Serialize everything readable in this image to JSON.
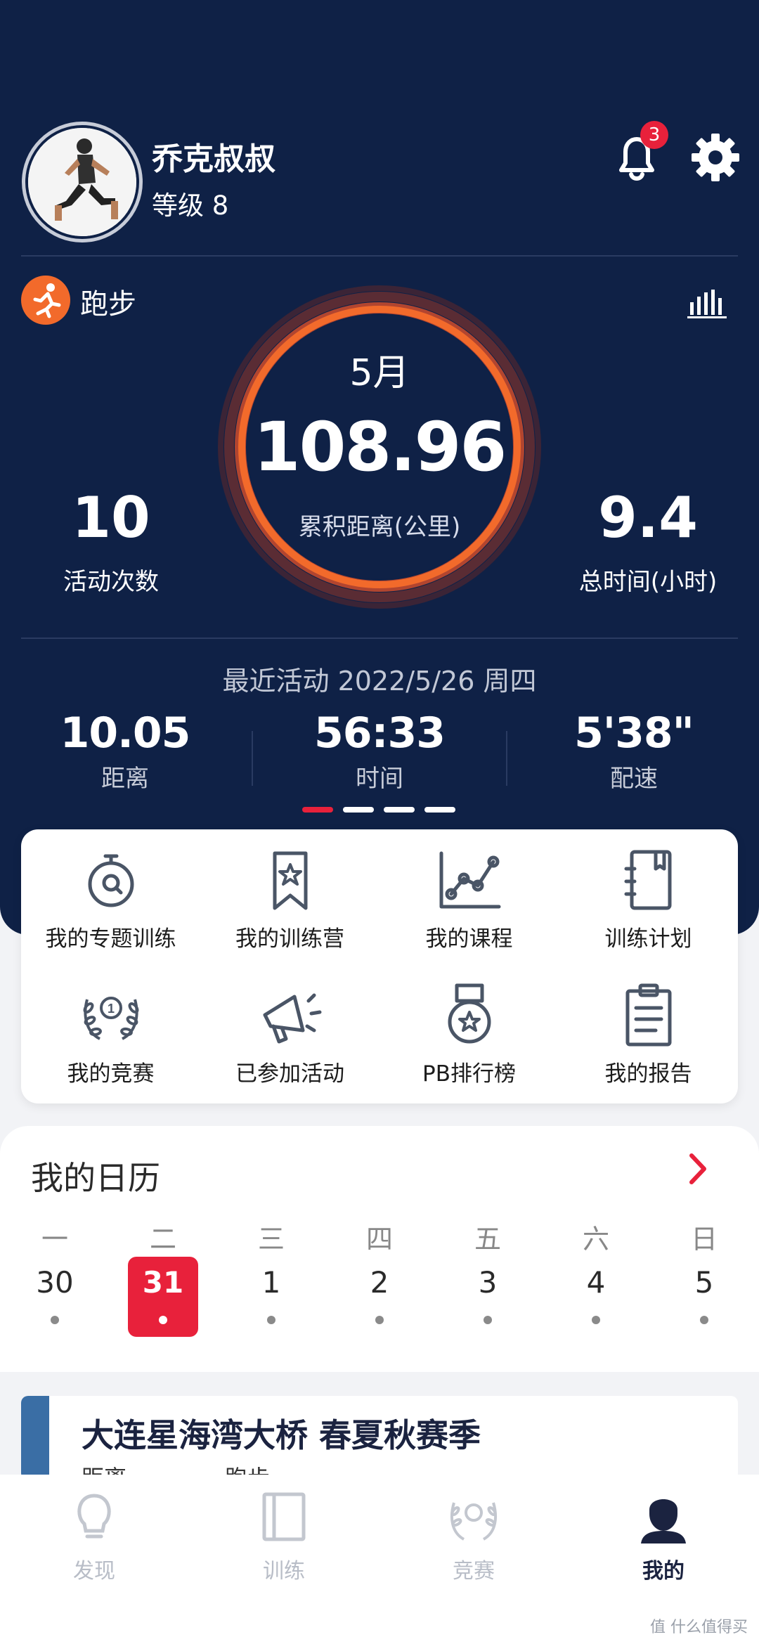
{
  "profile": {
    "name": "乔克叔叔",
    "level": "等级 8",
    "notifications": "3"
  },
  "sport": {
    "label": "跑步"
  },
  "summary": {
    "month": "5月",
    "distance": "108.96",
    "distance_label": "累积距离(公里)",
    "activities": "10",
    "activities_label": "活动次数",
    "total_time": "9.4",
    "total_time_label": "总时间(小时)"
  },
  "recent": {
    "header": "最近活动 2022/5/26 周四",
    "stats": [
      {
        "value": "10.05",
        "label": "距离"
      },
      {
        "value": "56:33",
        "label": "时间"
      },
      {
        "value": "5'38\"",
        "label": "配速"
      }
    ]
  },
  "page_dots": {
    "count": 4,
    "active_index": 0,
    "active_color": "#e8213b"
  },
  "menu": [
    {
      "label": "我的专题训练",
      "icon": "stopwatch-icon"
    },
    {
      "label": "我的训练营",
      "icon": "bookmark-star-icon"
    },
    {
      "label": "我的课程",
      "icon": "line-chart-icon"
    },
    {
      "label": "训练计划",
      "icon": "plan-book-icon"
    },
    {
      "label": "我的竞赛",
      "icon": "laurel-trophy-icon"
    },
    {
      "label": "已参加活动",
      "icon": "megaphone-icon"
    },
    {
      "label": "PB排行榜",
      "icon": "medal-icon"
    },
    {
      "label": "我的报告",
      "icon": "clipboard-icon"
    }
  ],
  "calendar": {
    "title": "我的日历",
    "days": [
      {
        "weekday": "一",
        "date": "30",
        "selected": false
      },
      {
        "weekday": "二",
        "date": "31",
        "selected": true
      },
      {
        "weekday": "三",
        "date": "1",
        "selected": false
      },
      {
        "weekday": "四",
        "date": "2",
        "selected": false
      },
      {
        "weekday": "五",
        "date": "3",
        "selected": false
      },
      {
        "weekday": "六",
        "date": "4",
        "selected": false
      },
      {
        "weekday": "日",
        "date": "5",
        "selected": false
      }
    ]
  },
  "race": {
    "title": "大连星海湾大桥 春夏秋赛季",
    "distance_label": "距离",
    "type_label": "跑步"
  },
  "tabs": [
    {
      "label": "发现",
      "icon": "lightbulb-icon",
      "active": false
    },
    {
      "label": "训练",
      "icon": "book-icon",
      "active": false
    },
    {
      "label": "竞赛",
      "icon": "laurel-icon",
      "active": false
    },
    {
      "label": "我的",
      "icon": "user-icon",
      "active": true
    }
  ],
  "watermark": "值 什么值得买",
  "colors": {
    "navy": "#0f2146",
    "accent_red": "#e8213b",
    "ring_orange": "#f26a2b"
  }
}
